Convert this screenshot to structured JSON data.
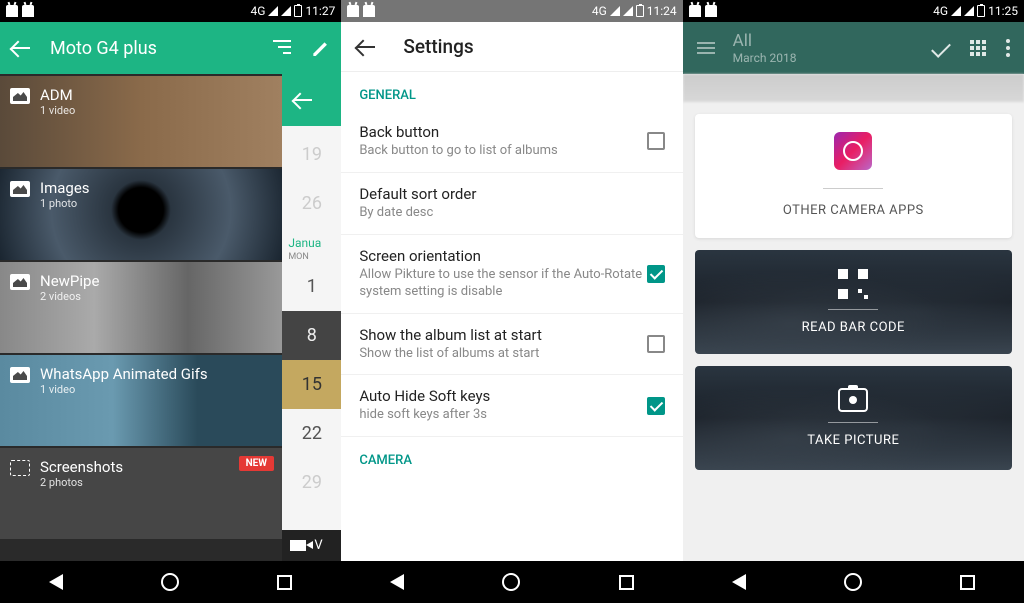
{
  "status": {
    "network": "4G",
    "times": {
      "s1": "11:27",
      "s2": "11:24",
      "s3": "11:25"
    }
  },
  "screen1": {
    "title": "Moto G4 plus",
    "albums": [
      {
        "name": "ADM",
        "count": "1 video"
      },
      {
        "name": "Images",
        "count": "1 photo"
      },
      {
        "name": "NewPipe",
        "count": "2 videos"
      },
      {
        "name": "WhatsApp Animated Gifs",
        "count": "1 video"
      },
      {
        "name": "Screenshots",
        "count": "2 photos"
      }
    ],
    "new_badge": "NEW",
    "calendar": {
      "rows": [
        "19",
        "26",
        "1",
        "8",
        "15",
        "22",
        "29"
      ],
      "month": "Janua",
      "dow": "MON",
      "video_label": "V"
    }
  },
  "screen2": {
    "title": "Settings",
    "sections": {
      "general": "GENERAL",
      "camera": "CAMERA"
    },
    "items": [
      {
        "title": "Back button",
        "sub": "Back button to go to list of albums",
        "checked": false
      },
      {
        "title": "Default sort order",
        "sub": "By date desc",
        "checked": null
      },
      {
        "title": "Screen orientation",
        "sub": "Allow Pikture to use the sensor if the Auto-Rotate system setting is disable",
        "checked": true
      },
      {
        "title": "Show the album list at start",
        "sub": "Show the list of albums at start",
        "checked": false
      },
      {
        "title": "Auto Hide Soft keys",
        "sub": "hide soft keys after 3s",
        "checked": true
      }
    ]
  },
  "screen3": {
    "title": "All",
    "subtitle": "March 2018",
    "cards": {
      "other": "OTHER CAMERA APPS",
      "barcode": "READ BAR CODE",
      "picture": "TAKE PICTURE"
    }
  }
}
